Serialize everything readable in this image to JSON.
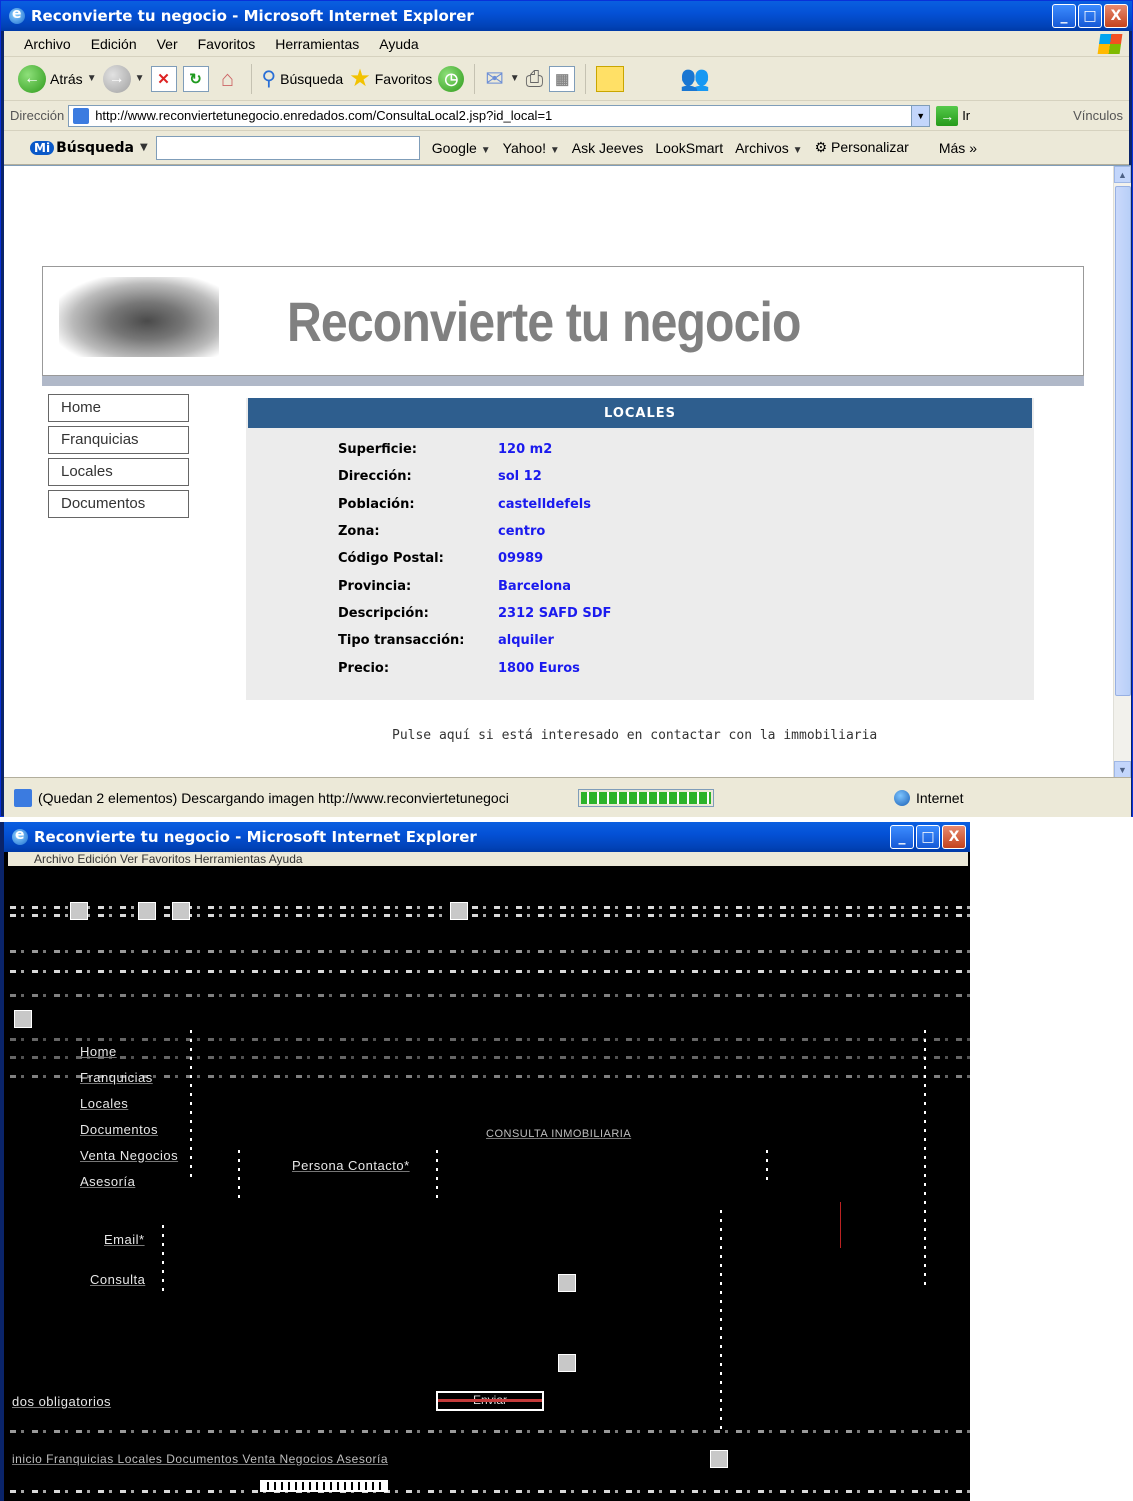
{
  "window": {
    "title": "Reconvierte tu negocio - Microsoft Internet Explorer",
    "controls": [
      "_",
      "□",
      "X"
    ]
  },
  "menu": [
    "Archivo",
    "Edición",
    "Ver",
    "Favoritos",
    "Herramientas",
    "Ayuda"
  ],
  "toolbar": {
    "back_label": "Atrás",
    "search_label": "Búsqueda",
    "favorites_label": "Favoritos"
  },
  "address": {
    "label": "Dirección",
    "url": "http://www.reconviertetunegocio.enredados.com/ConsultaLocal2.jsp?id_local=1",
    "go_label": "Ir",
    "links_label": "Vínculos"
  },
  "searchbar": {
    "brand": "Búsqueda",
    "brand_badge": "Mi",
    "items": [
      "Google",
      "Yahoo!",
      "Ask Jeeves",
      "LookSmart",
      "Archivos",
      "Personalizar",
      "Más"
    ]
  },
  "page": {
    "banner_title": "Reconvierte tu negocio",
    "nav": [
      "Home",
      "Franquicias",
      "Locales",
      "Documentos"
    ],
    "panel_title": "LOCALES",
    "details": [
      {
        "label": "Superficie:",
        "value": "120 m2"
      },
      {
        "label": "Dirección:",
        "value": "sol 12"
      },
      {
        "label": "Población:",
        "value": "castelldefels"
      },
      {
        "label": "Zona:",
        "value": "centro"
      },
      {
        "label": "Código Postal:",
        "value": "09989"
      },
      {
        "label": "Provincia:",
        "value": "Barcelona"
      },
      {
        "label": "Descripción:",
        "value": "2312 SAFD SDF"
      },
      {
        "label": "Tipo transacción:",
        "value": "alquiler"
      },
      {
        "label": "Precio:",
        "value": "1800 Euros"
      }
    ],
    "contact_text": "Pulse aquí si está interesado en contactar con la immobiliaria"
  },
  "status": {
    "text": "(Quedan 2 elementos) Descargando imagen http://www.reconviertetunegoci",
    "zone": "Internet",
    "progress": 0.9
  },
  "window2": {
    "title": "Reconvierte tu negocio - Microsoft Internet Explorer",
    "menu_text": "Archivo  Edición  Ver  Favoritos  Herramientas  Ayuda",
    "nav": [
      "Home",
      "Franquicias",
      "Locales",
      "Documentos",
      "Venta Negocios",
      "Asesoría"
    ],
    "form_title": "CONSULTA INMOBILIARIA",
    "field_person": "Persona Contacto*",
    "field_email": "Email*",
    "field_query": "Consulta",
    "required_note": "dos obligatorios",
    "send_label": "Enviar",
    "footer_links": "inicio  Franquicias  Locales  Documentos  Venta Negocios  Asesoría"
  }
}
